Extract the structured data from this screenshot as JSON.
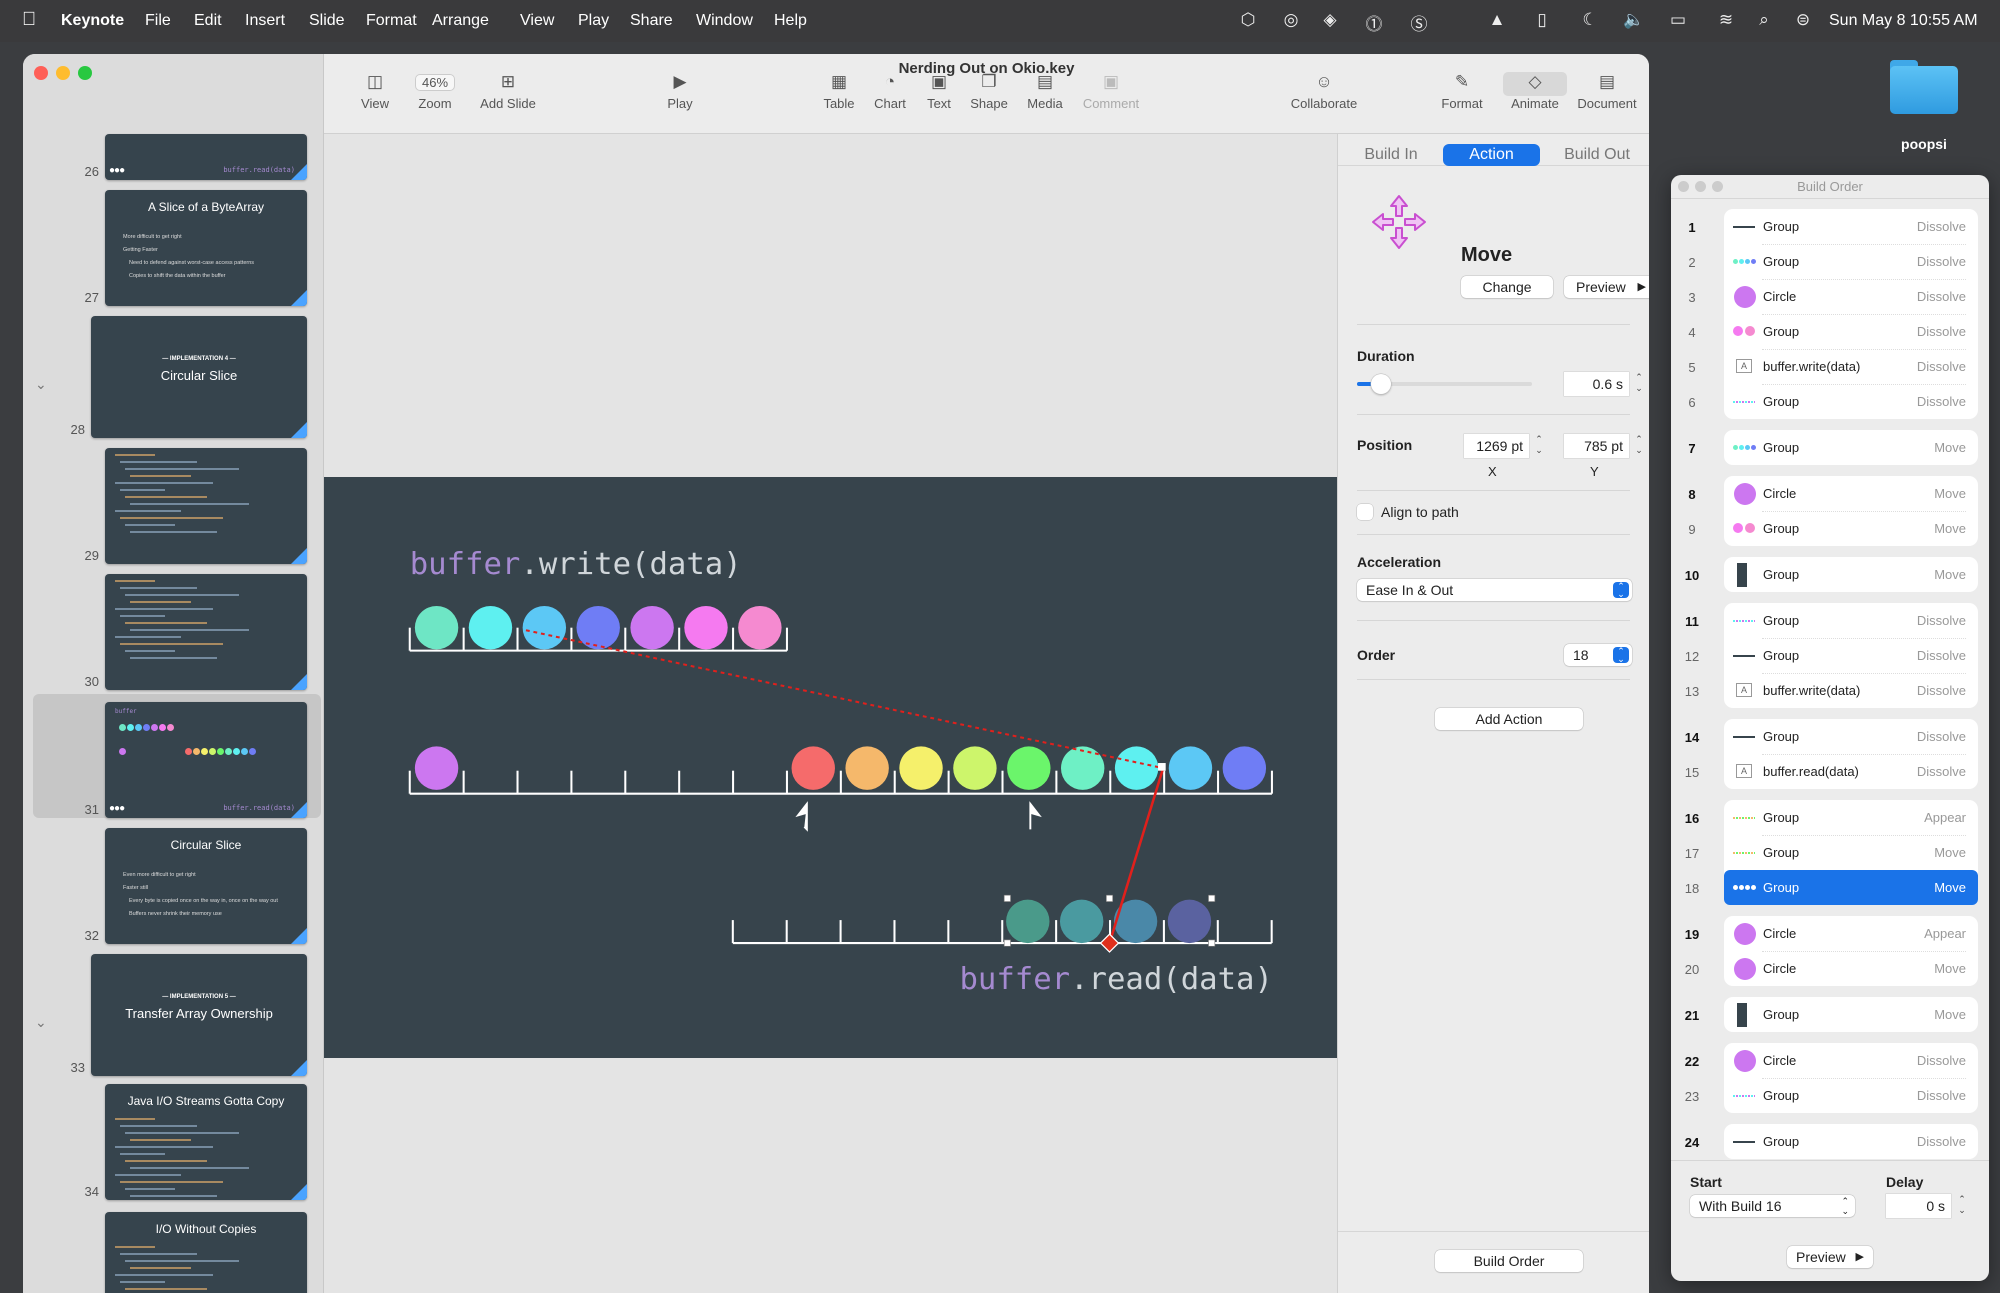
{
  "menubar": {
    "app": "Keynote",
    "items": [
      "File",
      "Edit",
      "Insert",
      "Slide",
      "Format",
      "Arrange",
      "View",
      "Play",
      "Share",
      "Window",
      "Help"
    ],
    "clock": "Sun May 8  10:55 AM",
    "status_icons": [
      "cube-icon",
      "network-icon",
      "sync-icon",
      "1password-icon",
      "scrivener-icon",
      "drive-icon",
      "door-icon",
      "moon-icon",
      "volume-icon",
      "battery-icon",
      "wifi-icon",
      "search-icon",
      "control-center-icon"
    ]
  },
  "desktop": {
    "folder_label": "poopsi"
  },
  "window": {
    "title": "Nerding Out on Okio.key",
    "toolbar": {
      "view": "View",
      "zoom_value": "46%",
      "zoom": "Zoom",
      "add_slide": "Add Slide",
      "play": "Play",
      "table": "Table",
      "chart": "Chart",
      "text": "Text",
      "shape": "Shape",
      "media": "Media",
      "comment": "Comment",
      "collaborate": "Collaborate",
      "format": "Format",
      "animate": "Animate",
      "document": "Document"
    }
  },
  "slides": [
    {
      "num": "26",
      "title": "",
      "sub": "",
      "kind": "partial",
      "caption": "buffer.read(data)"
    },
    {
      "num": "27",
      "title": "A Slice of a ByteArray",
      "kind": "bullets",
      "bullets": [
        "More difficult to get right",
        "Getting Faster",
        "Need to defend against worst-case access patterns",
        "Copies to shift the data within the buffer"
      ]
    },
    {
      "num": "28",
      "title": "Circular Slice",
      "sub": "— IMPLEMENTATION 4 —",
      "kind": "section"
    },
    {
      "num": "29",
      "title": "",
      "kind": "code"
    },
    {
      "num": "30",
      "title": "",
      "kind": "code"
    },
    {
      "num": "31",
      "title": "",
      "kind": "current",
      "caption": "buffer.read(data)"
    },
    {
      "num": "32",
      "title": "Circular Slice",
      "kind": "bullets",
      "bullets": [
        "Even more difficult to get right",
        "Faster still",
        "Every byte is copied once on the way in, once on the way out",
        "Buffers never shrink their memory use"
      ]
    },
    {
      "num": "33",
      "title": "Transfer Array Ownership",
      "sub": "— IMPLEMENTATION 5 —",
      "kind": "section"
    },
    {
      "num": "34",
      "title": "Java I/O Streams Gotta Copy",
      "kind": "code"
    },
    {
      "num": "",
      "title": "I/O Without Copies",
      "kind": "code"
    }
  ],
  "slide": {
    "write_label_obj": "buffer",
    "write_label_call": ".write(data)",
    "read_label_obj": "buffer",
    "read_label_call": ".read(data)",
    "colors": {
      "background": "#37444c",
      "keyword": "#a58ad0",
      "text": "#d0d6da",
      "path": "#e0201c"
    },
    "top_row": [
      "#6ee6c5",
      "#5ef0f0",
      "#5cc8f5",
      "#6f7df5",
      "#cc77f0",
      "#f57af0",
      "#f58ad0"
    ],
    "middle_row_first": "#cc77f0",
    "middle_row": [
      "#f56b6b",
      "#f5b86b",
      "#f5f06b",
      "#cdf56b",
      "#6bf56b",
      "#6ef0c5",
      "#5ef0f0",
      "#5cc8f5",
      "#6f7df5"
    ],
    "bottom_row": [
      "#4a9a8a",
      "#4a9aa0",
      "#4a88a8",
      "#5a62a0"
    ]
  },
  "inspector": {
    "tabs": [
      "Build In",
      "Action",
      "Build Out"
    ],
    "active_tab": "Action",
    "effect": "Move",
    "change": "Change",
    "preview": "Preview",
    "duration_label": "Duration",
    "duration_value": "0.6 s",
    "duration_fraction": 0.1,
    "position_label": "Position",
    "x_value": "1269 pt",
    "x_label": "X",
    "y_value": "785 pt",
    "y_label": "Y",
    "align_to_path": "Align to path",
    "align_checked": false,
    "acceleration_label": "Acceleration",
    "acceleration_value": "Ease In & Out",
    "order_label": "Order",
    "order_value": "18",
    "add_action": "Add Action",
    "build_order": "Build Order",
    "accent": "#1a73e8"
  },
  "build_order": {
    "title": "Build Order",
    "groups": [
      [
        {
          "n": "1",
          "name": "Group",
          "effect": "Dissolve",
          "icon": "line"
        },
        {
          "n": "2",
          "name": "Group",
          "effect": "Dissolve",
          "icon": "dots4"
        },
        {
          "n": "3",
          "name": "Circle",
          "effect": "Dissolve",
          "icon": "circle"
        },
        {
          "n": "4",
          "name": "Group",
          "effect": "Dissolve",
          "icon": "dots2"
        },
        {
          "n": "5",
          "name": "buffer.write(data)",
          "effect": "Dissolve",
          "icon": "text"
        },
        {
          "n": "6",
          "name": "Group",
          "effect": "Dissolve",
          "icon": "dotline"
        }
      ],
      [
        {
          "n": "7",
          "name": "Group",
          "effect": "Move",
          "icon": "dots4"
        }
      ],
      [
        {
          "n": "8",
          "name": "Circle",
          "effect": "Move",
          "icon": "circle"
        },
        {
          "n": "9",
          "name": "Group",
          "effect": "Move",
          "icon": "dots2"
        }
      ],
      [
        {
          "n": "10",
          "name": "Group",
          "effect": "Move",
          "icon": "rect"
        }
      ],
      [
        {
          "n": "11",
          "name": "Group",
          "effect": "Dissolve",
          "icon": "dotline"
        },
        {
          "n": "12",
          "name": "Group",
          "effect": "Dissolve",
          "icon": "line"
        },
        {
          "n": "13",
          "name": "buffer.write(data)",
          "effect": "Dissolve",
          "icon": "text"
        }
      ],
      [
        {
          "n": "14",
          "name": "Group",
          "effect": "Dissolve",
          "icon": "line"
        },
        {
          "n": "15",
          "name": "buffer.read(data)",
          "effect": "Dissolve",
          "icon": "text"
        }
      ],
      [
        {
          "n": "16",
          "name": "Group",
          "effect": "Appear",
          "icon": "dotline2"
        },
        {
          "n": "17",
          "name": "Group",
          "effect": "Move",
          "icon": "dotline2"
        },
        {
          "n": "18",
          "name": "Group",
          "effect": "Move",
          "icon": "dots4",
          "selected": true
        }
      ],
      [
        {
          "n": "19",
          "name": "Circle",
          "effect": "Appear",
          "icon": "circle"
        },
        {
          "n": "20",
          "name": "Circle",
          "effect": "Move",
          "icon": "circle"
        }
      ],
      [
        {
          "n": "21",
          "name": "Group",
          "effect": "Move",
          "icon": "rect"
        }
      ],
      [
        {
          "n": "22",
          "name": "Circle",
          "effect": "Dissolve",
          "icon": "circle"
        },
        {
          "n": "23",
          "name": "Group",
          "effect": "Dissolve",
          "icon": "dotline"
        }
      ],
      [
        {
          "n": "24",
          "name": "Group",
          "effect": "Dissolve",
          "icon": "line"
        }
      ]
    ],
    "start_label": "Start",
    "start_value": "With Build 16",
    "delay_label": "Delay",
    "delay_value": "0 s",
    "preview": "Preview"
  }
}
